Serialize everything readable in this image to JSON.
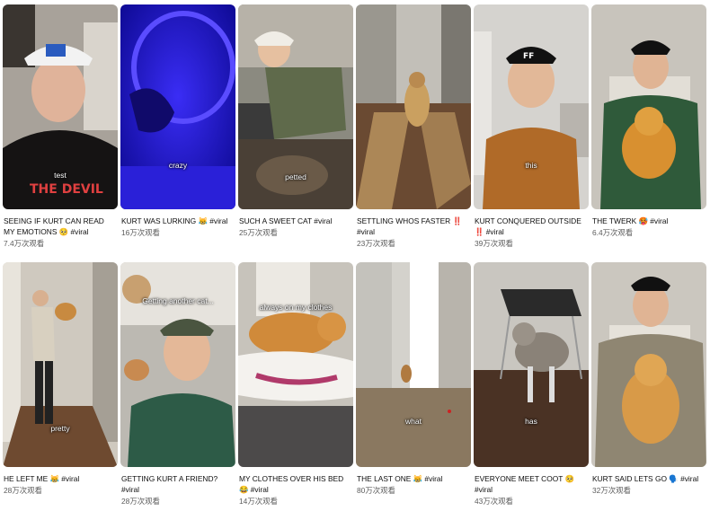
{
  "videos": [
    {
      "overlay": "test",
      "title": "SEEING IF KURT CAN READ MY EMOTIONS 🥺 #viral",
      "views": "7.4万次观看",
      "colors": {
        "top": "#a8a29a",
        "bottom": "#151313",
        "accent": "#2a2a2a"
      }
    },
    {
      "overlay": "crazy",
      "title": "KURT WAS LURKING 😹 #viral",
      "views": "16万次观看",
      "colors": {
        "top": "#1a10c8",
        "bottom": "#3c2df0",
        "accent": "#0b0870"
      }
    },
    {
      "overlay": "petted",
      "title": "SUCH A SWEET CAT #viral",
      "views": "25万次观看",
      "colors": {
        "top": "#8b8a80",
        "bottom": "#4a4036",
        "accent": "#5f6a4b"
      }
    },
    {
      "overlay": "",
      "title": "SETTLING WHOS FASTER ‼️ #viral",
      "views": "23万次观看",
      "colors": {
        "top": "#c2bfb8",
        "bottom": "#6a4a32",
        "accent": "#caa060"
      }
    },
    {
      "overlay": "this",
      "title": "KURT CONQUERED OUTSIDE ‼️ #viral",
      "views": "39万次观看",
      "colors": {
        "top": "#d5d3cf",
        "bottom": "#b06a28",
        "accent": "#c07528"
      }
    },
    {
      "overlay": "",
      "title": "THE TWERK 🥵 #viral",
      "views": "6.4万次观看",
      "colors": {
        "top": "#c8c4bc",
        "bottom": "#2f5a3a",
        "accent": "#d89030"
      }
    },
    {
      "overlay": "pretty",
      "title": "HE LEFT ME 😹 #viral",
      "views": "28万次观看",
      "colors": {
        "top": "#cfc9bf",
        "bottom": "#6e4a30",
        "accent": "#222222"
      }
    },
    {
      "overlay": "Getting another cat...",
      "title": "GETTING KURT A FRIEND? #viral",
      "views": "28万次观看",
      "colors": {
        "top": "#bcb9b2",
        "bottom": "#2d5b47",
        "accent": "#6a7d5a"
      }
    },
    {
      "overlay": "always on my clothes",
      "title": "MY CLOTHES OVER HIS BED 😂 #viral",
      "views": "14万次观看",
      "colors": {
        "top": "#c7c3bb",
        "bottom": "#4c4a4a",
        "accent": "#d08a3a"
      }
    },
    {
      "overlay": "what",
      "title": "THE LAST ONE 😹 #viral",
      "views": "80万次观看",
      "colors": {
        "top": "#d4d2cc",
        "bottom": "#8a7860",
        "accent": "#ffffff"
      }
    },
    {
      "overlay": "has",
      "title": "EVERYONE MEET COOT 🥺 #viral",
      "views": "43万次观看",
      "colors": {
        "top": "#c9c6c0",
        "bottom": "#4a3224",
        "accent": "#8a8278"
      }
    },
    {
      "overlay": "",
      "title": "KURT SAID LETS GO 🗣️ #viral",
      "views": "32万次观看",
      "colors": {
        "top": "#cbc7bf",
        "bottom": "#8f8672",
        "accent": "#d89a48"
      }
    }
  ]
}
